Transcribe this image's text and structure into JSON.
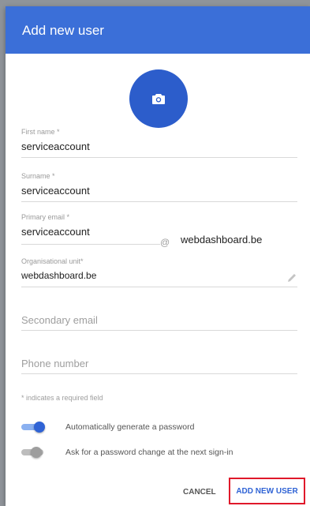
{
  "header": {
    "title": "Add new user"
  },
  "avatar": {
    "icon": "camera-icon"
  },
  "form": {
    "first_name": {
      "label": "First name *",
      "value": "serviceaccount"
    },
    "surname": {
      "label": "Surname *",
      "value": "serviceaccount"
    },
    "primary_email": {
      "label": "Primary email *",
      "value": "serviceaccount",
      "at": "@",
      "domain": "webdashboard.be"
    },
    "org_unit": {
      "label": "Organisational unit*",
      "value": "webdashboard.be",
      "edit_icon": "pencil-icon"
    },
    "secondary_email": {
      "placeholder": "Secondary email"
    },
    "phone": {
      "placeholder": "Phone number"
    },
    "required_hint": "* indicates a required field"
  },
  "toggles": {
    "auto_password": {
      "label": "Automatically generate a password",
      "state": "on"
    },
    "password_change": {
      "label": "Ask for a password change at the next sign-in",
      "state": "off"
    }
  },
  "actions": {
    "cancel": "CANCEL",
    "add": "ADD NEW USER"
  },
  "colors": {
    "header": "#3b6fd8",
    "accent": "#2f63d5",
    "highlight": "#e0192a"
  }
}
